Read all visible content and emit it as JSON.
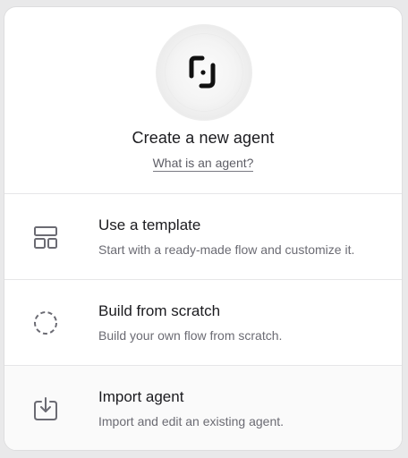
{
  "header": {
    "logo_icon": "brand-logo-icon",
    "title": "Create a new agent",
    "help_link": "What is an agent?"
  },
  "options": [
    {
      "icon": "template-icon",
      "title": "Use a template",
      "description": "Start with a ready-made flow and customize it."
    },
    {
      "icon": "dashed-circle-icon",
      "title": "Build from scratch",
      "description": "Build your own flow from scratch."
    },
    {
      "icon": "import-icon",
      "title": "Import agent",
      "description": "Import and edit an existing agent."
    }
  ],
  "colors": {
    "text_primary": "#1b1b1f",
    "text_secondary": "#6b6b73",
    "icon": "#6b6b73"
  }
}
